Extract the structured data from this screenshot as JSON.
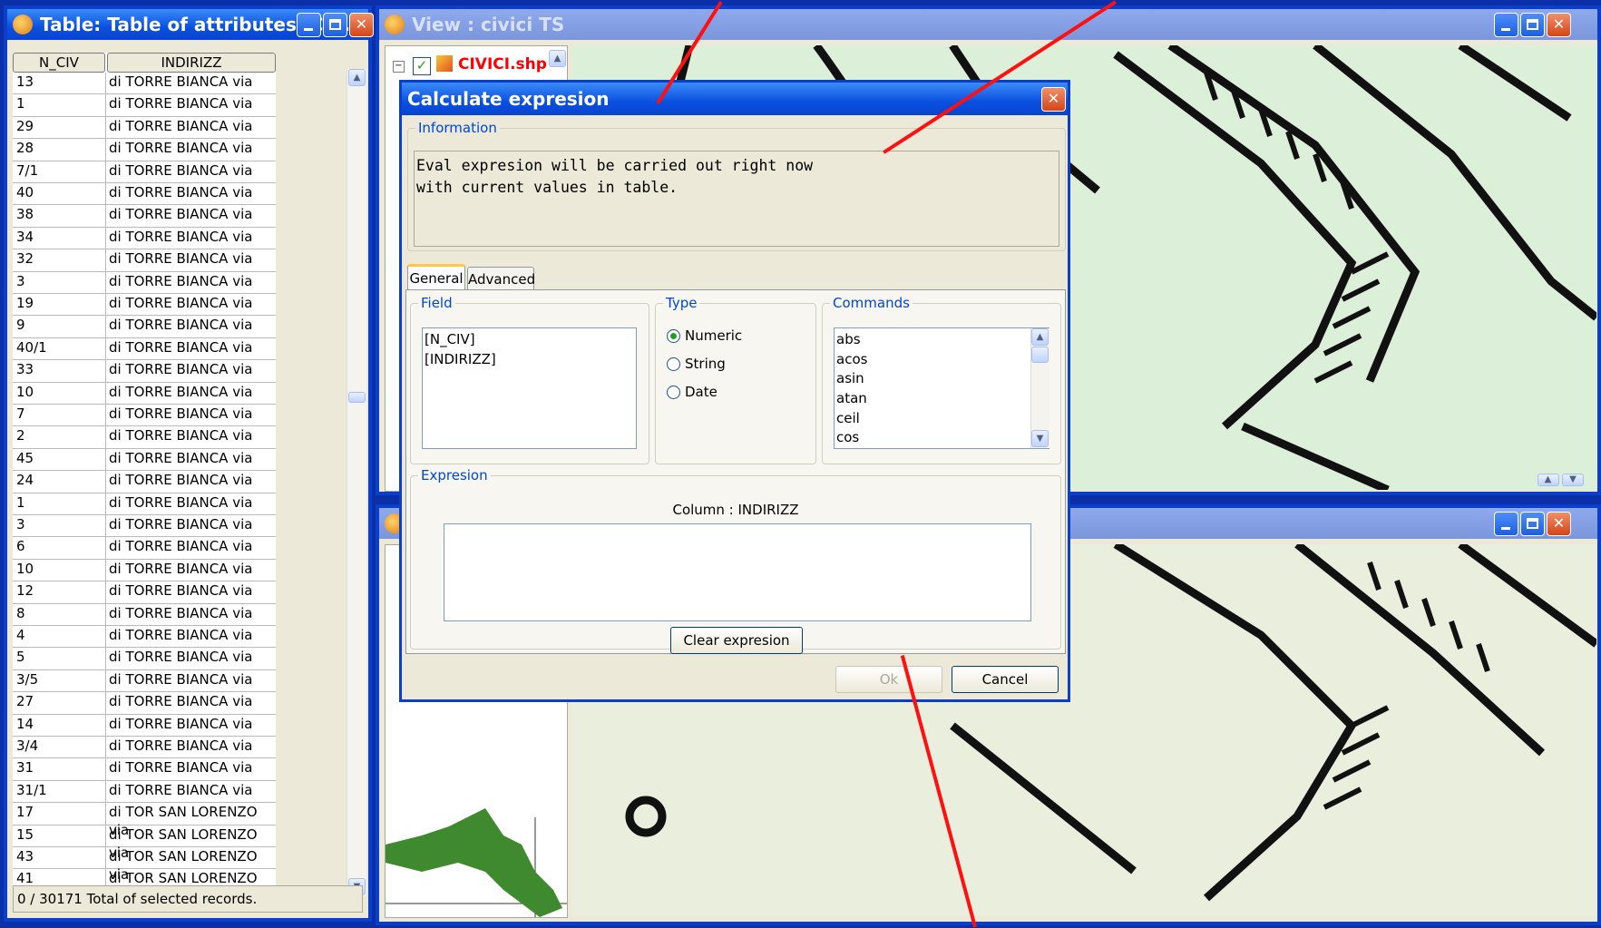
{
  "table_window": {
    "title": "Table: Table of attributes: Cl...",
    "columns": [
      "N_CIV",
      "INDIRIZZ"
    ],
    "rows": [
      [
        "13",
        "di TORRE BIANCA via"
      ],
      [
        "1",
        "di TORRE BIANCA via"
      ],
      [
        "29",
        "di TORRE BIANCA via"
      ],
      [
        "28",
        "di TORRE BIANCA via"
      ],
      [
        "7/1",
        "di TORRE BIANCA via"
      ],
      [
        "40",
        "di TORRE BIANCA via"
      ],
      [
        "38",
        "di TORRE BIANCA via"
      ],
      [
        "34",
        "di TORRE BIANCA via"
      ],
      [
        "32",
        "di TORRE BIANCA via"
      ],
      [
        "3",
        "di TORRE BIANCA via"
      ],
      [
        "19",
        "di TORRE BIANCA via"
      ],
      [
        "9",
        "di TORRE BIANCA via"
      ],
      [
        "40/1",
        "di TORRE BIANCA via"
      ],
      [
        "33",
        "di TORRE BIANCA via"
      ],
      [
        "10",
        "di TORRE BIANCA via"
      ],
      [
        "7",
        "di TORRE BIANCA via"
      ],
      [
        "2",
        "di TORRE BIANCA via"
      ],
      [
        "45",
        "di TORRE BIANCA via"
      ],
      [
        "24",
        "di TORRE BIANCA via"
      ],
      [
        "1",
        "di TORRE BIANCA via"
      ],
      [
        "3",
        "di TORRE BIANCA via"
      ],
      [
        "6",
        "di TORRE BIANCA via"
      ],
      [
        "10",
        "di TORRE BIANCA via"
      ],
      [
        "12",
        "di TORRE BIANCA via"
      ],
      [
        "8",
        "di TORRE BIANCA via"
      ],
      [
        "4",
        "di TORRE BIANCA via"
      ],
      [
        "5",
        "di TORRE BIANCA via"
      ],
      [
        "3/5",
        "di TORRE BIANCA via"
      ],
      [
        "27",
        "di TORRE BIANCA via"
      ],
      [
        "14",
        "di TORRE BIANCA via"
      ],
      [
        "3/4",
        "di TORRE BIANCA via"
      ],
      [
        "31",
        "di TORRE BIANCA via"
      ],
      [
        "31/1",
        "di TORRE BIANCA via"
      ],
      [
        "17",
        "di TOR SAN LORENZO via"
      ],
      [
        "15",
        "di TOR SAN LORENZO via"
      ],
      [
        "43",
        "di TOR SAN LORENZO via"
      ],
      [
        "41",
        "di TOR SAN LORENZO via"
      ]
    ],
    "status": "0 / 30171 Total of selected records."
  },
  "view_window": {
    "title": "View : civici TS",
    "layer_name": "CIVICI.shp"
  },
  "dialog": {
    "title": "Calculate expresion",
    "info_legend": "Information",
    "info_line1": "Eval expresion will be carried out right now",
    "info_line2": "with current values in table.",
    "tabs": [
      "General",
      "Advanced"
    ],
    "field_legend": "Field",
    "fields": [
      "[N_CIV]",
      "[INDIRIZZ]"
    ],
    "type_legend": "Type",
    "types": [
      "Numeric",
      "String",
      "Date"
    ],
    "selected_type": "Numeric",
    "commands_legend": "Commands",
    "commands": [
      "abs",
      "acos",
      "asin",
      "atan",
      "ceil",
      "cos"
    ],
    "expresion_legend": "Expresion",
    "column_label": "Column : INDIRIZZ",
    "expression_value": "",
    "clear_button": "Clear expresion",
    "ok_button": "Ok",
    "cancel_button": "Cancel"
  },
  "colors": {
    "titlebar": "#0a4fe0",
    "annotation_arrow": "#ff1010",
    "legend_text": "#0046d5"
  }
}
